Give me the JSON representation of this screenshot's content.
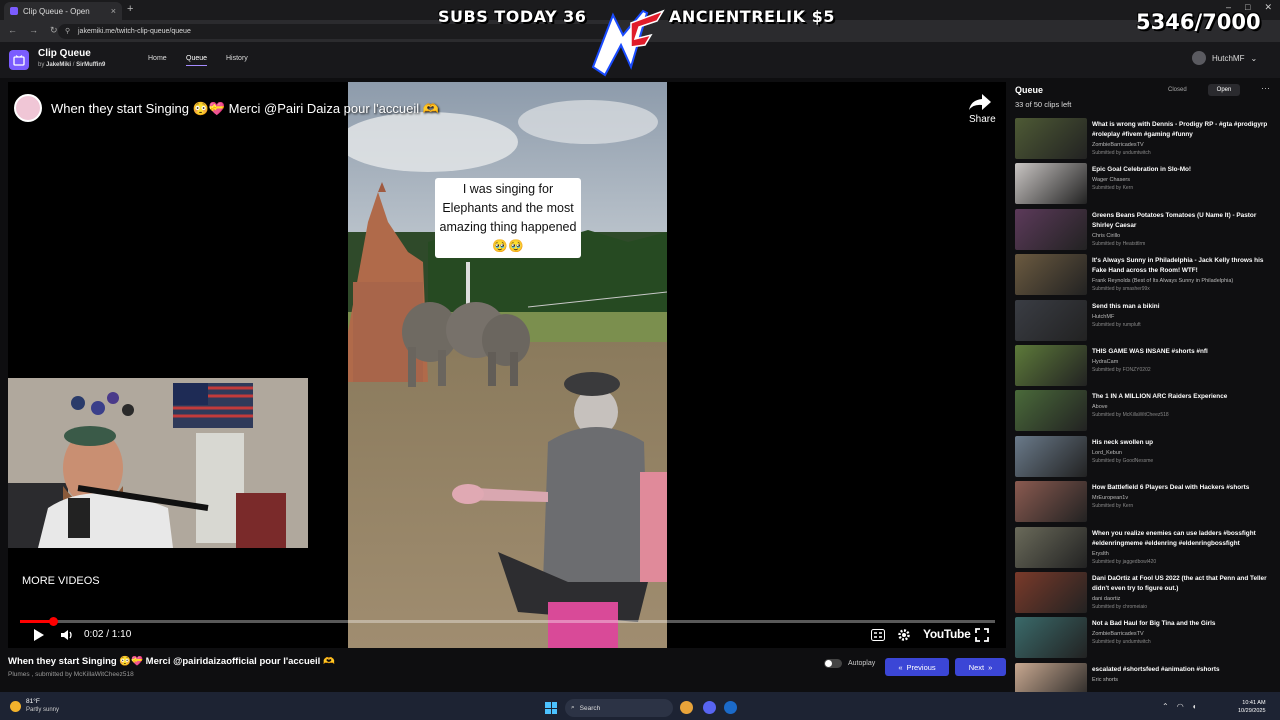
{
  "browser": {
    "tab_title": "Clip Queue - Open",
    "tab_close": "×",
    "new_tab": "+",
    "url": "jakemiki.me/twitch-clip-queue/queue"
  },
  "overlay": {
    "subs_today": "SUBS TODAY 36",
    "latest_donor": "ANCIENTRELIK  $5",
    "goal": "5346/7000",
    "logo_text": "MF"
  },
  "app": {
    "name": "Clip Queue",
    "by_label": "by",
    "author1": "JakeMiki",
    "author2": "SirMuffin9",
    "nav": [
      "Home",
      "Queue",
      "History"
    ],
    "username": "HutchMF"
  },
  "player": {
    "video_title": "When they start Singing 😳💝 Merci @Pairi Daiza pour l'accueil 🫶",
    "share_label": "Share",
    "caption": "I was singing for Elephants and the most amazing thing happened 🥹🥹",
    "more_videos": "MORE VIDEOS",
    "time": "0:02 / 1:10",
    "progress": 0.034,
    "youtube_label": "YouTube"
  },
  "clip": {
    "title": "When they start Singing 😳💝 Merci @pairidaizaofficial pour l'accueil 🫶",
    "meta": "Plumes , submitted by McKillaWitCheez518",
    "autoplay_label": "Autoplay",
    "prev_label": "Previous",
    "next_label": "Next"
  },
  "queue": {
    "title": "Queue",
    "count": "33 of 50 clips left",
    "closed_label": "Closed",
    "open_label": "Open",
    "items": [
      {
        "title": "What is wrong with Dennis - Prodigy RP - #gta #prodigyrp #roleplay #fivem #gaming #funny",
        "channel": "ZombieBarricadesTV",
        "submitter": "Submitted by undumtwitch",
        "color": "#4e5a35"
      },
      {
        "title": "Epic Goal Celebration in Slo-Mo!",
        "channel": "Wager Chasers",
        "submitter": "Submitted by Kern",
        "color": "#c9c5c3"
      },
      {
        "title": "Greens Beans Potatoes Tomatoes (U Name It) - Pastor Shirley Caesar",
        "channel": "Chris Cirillo",
        "submitter": "Submitted by Heatsttlrm",
        "color": "#5c3a5a"
      },
      {
        "title": "It's Always Sunny in Philadelphia - Jack Kelly throws his Fake Hand across the Room! WTF!",
        "channel": "Frank Reynolds (Best of Its Always Sunny in Philadelphia)",
        "submitter": "Submitted by smasher99x",
        "color": "#6b5a40"
      },
      {
        "title": "Send this man a bikini",
        "channel": "HutchMF",
        "submitter": "Submitted by rumpluft",
        "color": "#3a3d44"
      },
      {
        "title": "THIS GAME WAS INSANE #shorts #nfl",
        "channel": "HydraCam",
        "submitter": "Submitted by FONZY0202",
        "color": "#5d7a3a"
      },
      {
        "title": "The 1 IN A MILLION ARC Raiders Experience",
        "channel": "Above",
        "submitter": "Submitted by McKillaWitCheez518",
        "color": "#4a6a3a"
      },
      {
        "title": "His neck swollen up",
        "channel": "Lord_Kebun",
        "submitter": "Submitted by GoodNessme",
        "color": "#6a7a8a"
      },
      {
        "title": "How Battlefield 6 Players Deal with Hackers #shorts",
        "channel": "MrEuropean1v",
        "submitter": "Submitted by Kern",
        "color": "#8a5a50"
      },
      {
        "title": "When you realize enemies can use ladders #bossfight #eldenringmeme #eldenring #eldenringbossfight",
        "channel": "Eryslth",
        "submitter": "Submitted by jaggedbowl420",
        "color": "#6a6a5a"
      },
      {
        "title": "Dani DaOrtiz at Fool US 2022 (the act that Penn and Teller didn't even try to figure out.)",
        "channel": "dani daortiz",
        "submitter": "Submitted by chromeiaio",
        "color": "#7a3a2a"
      },
      {
        "title": "Not a Bad Haul for Big Tina and the Girls",
        "channel": "ZombieBarricadesTV",
        "submitter": "Submitted by undumtwitch",
        "color": "#3a6a6a"
      },
      {
        "title": "escalated #shortsfeed #animation #shorts",
        "channel": "Eric shorts",
        "submitter": "",
        "color": "#c8a890"
      }
    ]
  },
  "taskbar": {
    "temp": "81°F",
    "weather": "Partly sunny",
    "search": "Search",
    "time": "10:41 AM",
    "date": "10/29/2025"
  },
  "colors": {
    "accent": "#7b5cff",
    "button": "#3b46d6",
    "youtube_red": "#ff0000"
  }
}
